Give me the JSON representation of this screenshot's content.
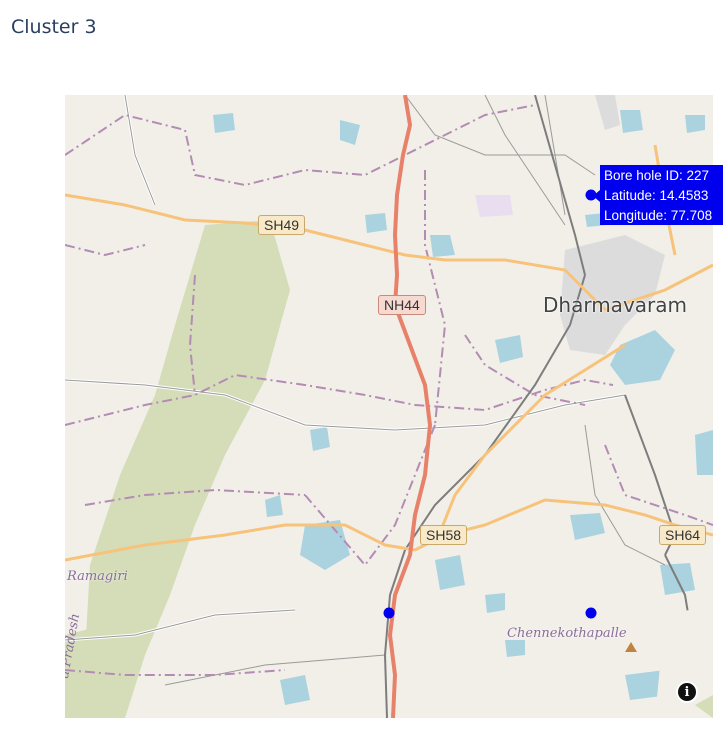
{
  "page_title": "Cluster 3",
  "map": {
    "place_labels": {
      "town": "Dharmavaram",
      "village_1": "Ramagiri",
      "village_2": "Chennekothapalle",
      "state": "a Pradesh"
    },
    "road_shields": {
      "sh49": "SH49",
      "nh44": "NH44",
      "sh58": "SH58",
      "sh64": "SH64"
    },
    "marker_color": "#0000ee",
    "markers_shown": 3,
    "hover_tooltip": {
      "line1": "Bore hole ID: 227",
      "line2": "Latitude: 14.4583",
      "line3": "Longitude: 77.708"
    },
    "info_icon": "info-icon"
  }
}
